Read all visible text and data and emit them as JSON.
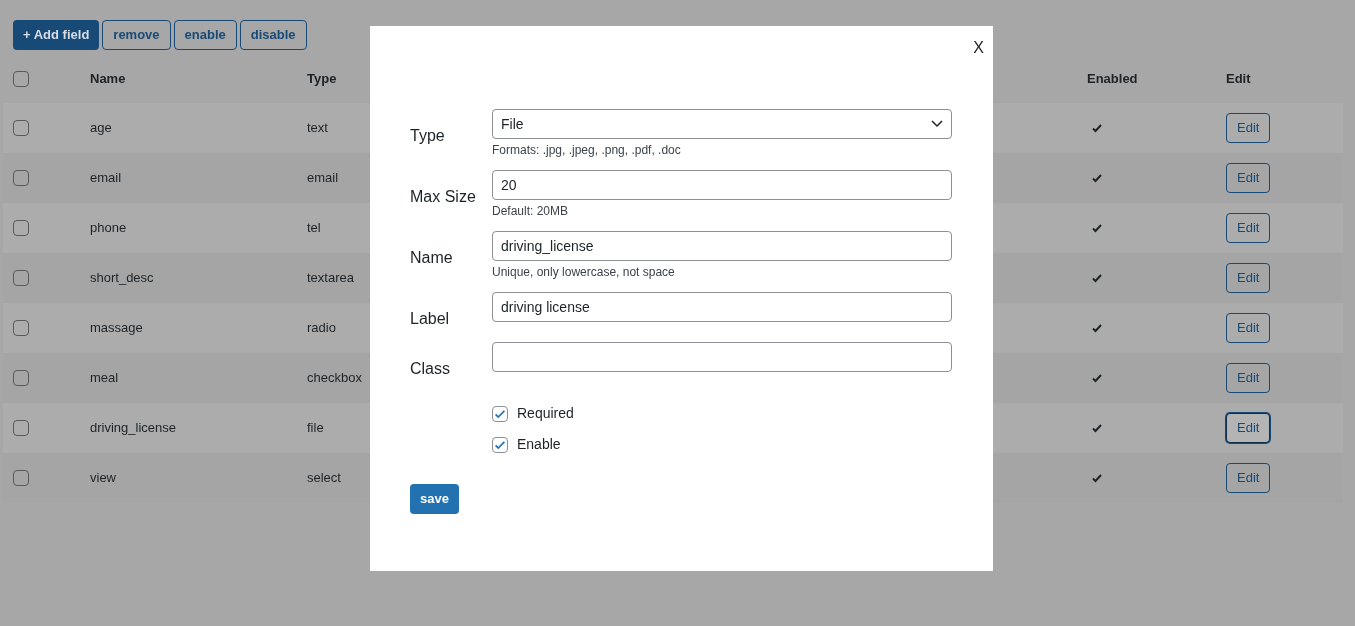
{
  "toolbar": {
    "add_button": "+ Add field",
    "buttons": [
      "remove",
      "enable",
      "disable"
    ]
  },
  "table": {
    "select_all_checked": false,
    "columns": [
      "Name",
      "Type",
      "Enabled",
      "Edit"
    ],
    "rows": [
      {
        "checked": false,
        "name": "age",
        "type": "text",
        "enabled": true,
        "edit": "Edit",
        "edit_focused": false
      },
      {
        "checked": false,
        "name": "email",
        "type": "email",
        "enabled": true,
        "edit": "Edit",
        "edit_focused": false
      },
      {
        "checked": false,
        "name": "phone",
        "type": "tel",
        "enabled": true,
        "edit": "Edit",
        "edit_focused": false
      },
      {
        "checked": false,
        "name": "short_desc",
        "type": "textarea",
        "enabled": true,
        "edit": "Edit",
        "edit_focused": false
      },
      {
        "checked": false,
        "name": "massage",
        "type": "radio",
        "enabled": true,
        "edit": "Edit",
        "edit_focused": false
      },
      {
        "checked": false,
        "name": "meal",
        "type": "checkbox",
        "enabled": true,
        "edit": "Edit",
        "edit_focused": false
      },
      {
        "checked": false,
        "name": "driving_license",
        "type": "file",
        "enabled": true,
        "edit": "Edit",
        "edit_focused": true
      },
      {
        "checked": false,
        "name": "view",
        "type": "select",
        "enabled": true,
        "edit": "Edit",
        "edit_focused": false
      }
    ]
  },
  "modal": {
    "close": "X",
    "fields": [
      {
        "kind": "select",
        "label": "Type",
        "value": "File",
        "hint": "Formats: .jpg, .jpeg, .png, .pdf, .doc"
      },
      {
        "kind": "input",
        "label": "Max Size",
        "value": "20",
        "hint": "Default: 20MB"
      },
      {
        "kind": "input",
        "label": "Name",
        "value": "driving_license",
        "hint": "Unique, only lowercase, not space"
      },
      {
        "kind": "input",
        "label": "Label",
        "value": "driving license"
      },
      {
        "kind": "input",
        "label": "Class"
      }
    ],
    "checkboxes": [
      {
        "label": "Required",
        "checked": true
      },
      {
        "label": "Enable",
        "checked": true
      }
    ],
    "save": "save"
  }
}
